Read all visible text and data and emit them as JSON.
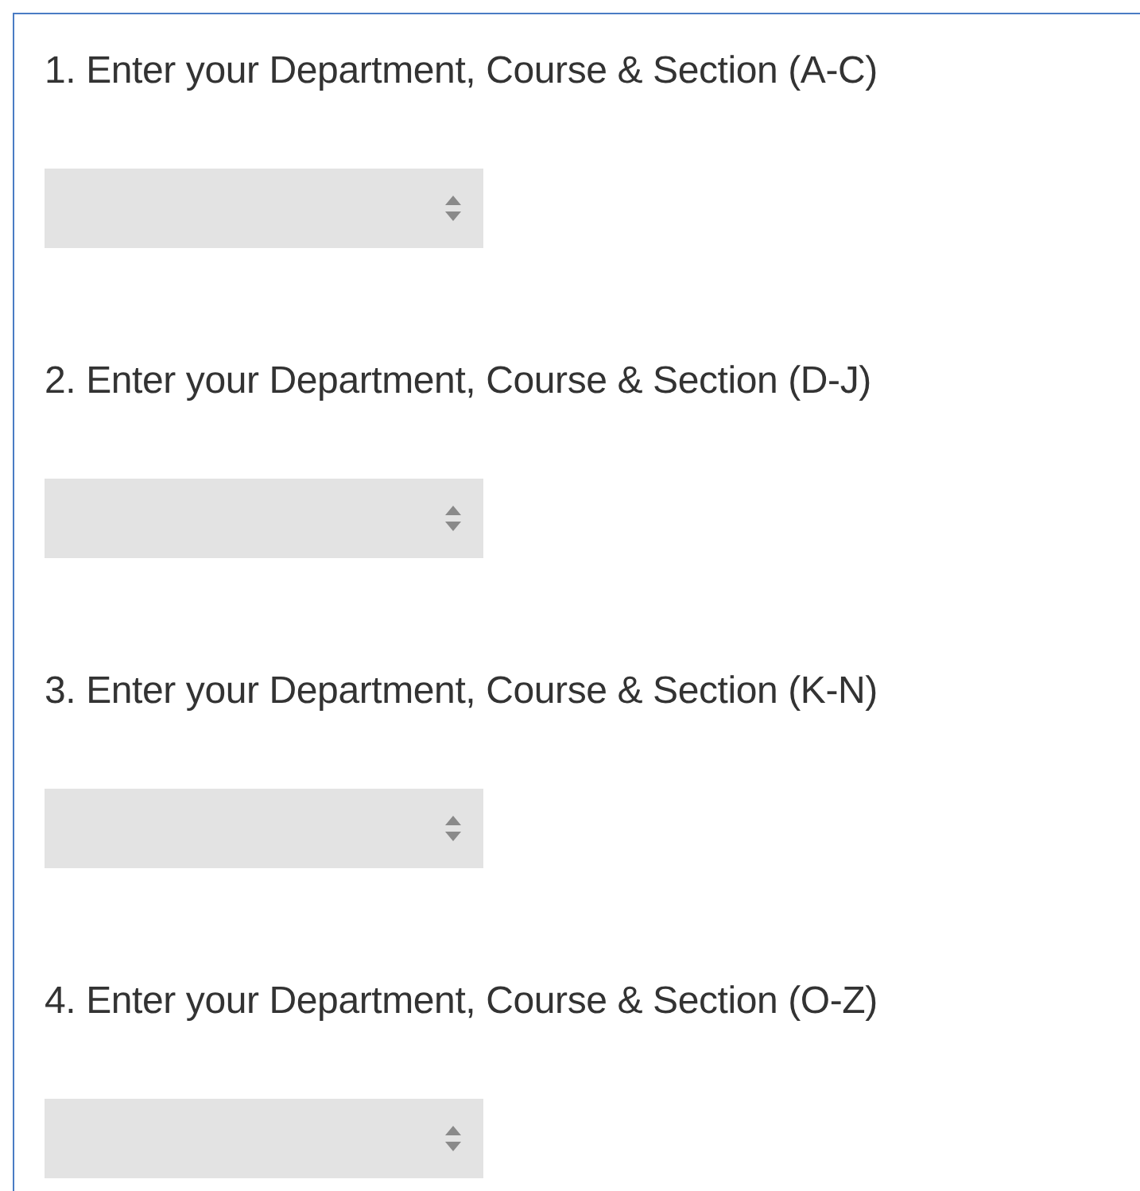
{
  "questions": [
    {
      "label": "1. Enter your Department, Course & Section (A-C)"
    },
    {
      "label": "2. Enter your Department, Course & Section (D-J)"
    },
    {
      "label": "3. Enter your Department, Course & Section (K-N)"
    },
    {
      "label": "4. Enter your Department, Course & Section (O-Z)"
    }
  ]
}
